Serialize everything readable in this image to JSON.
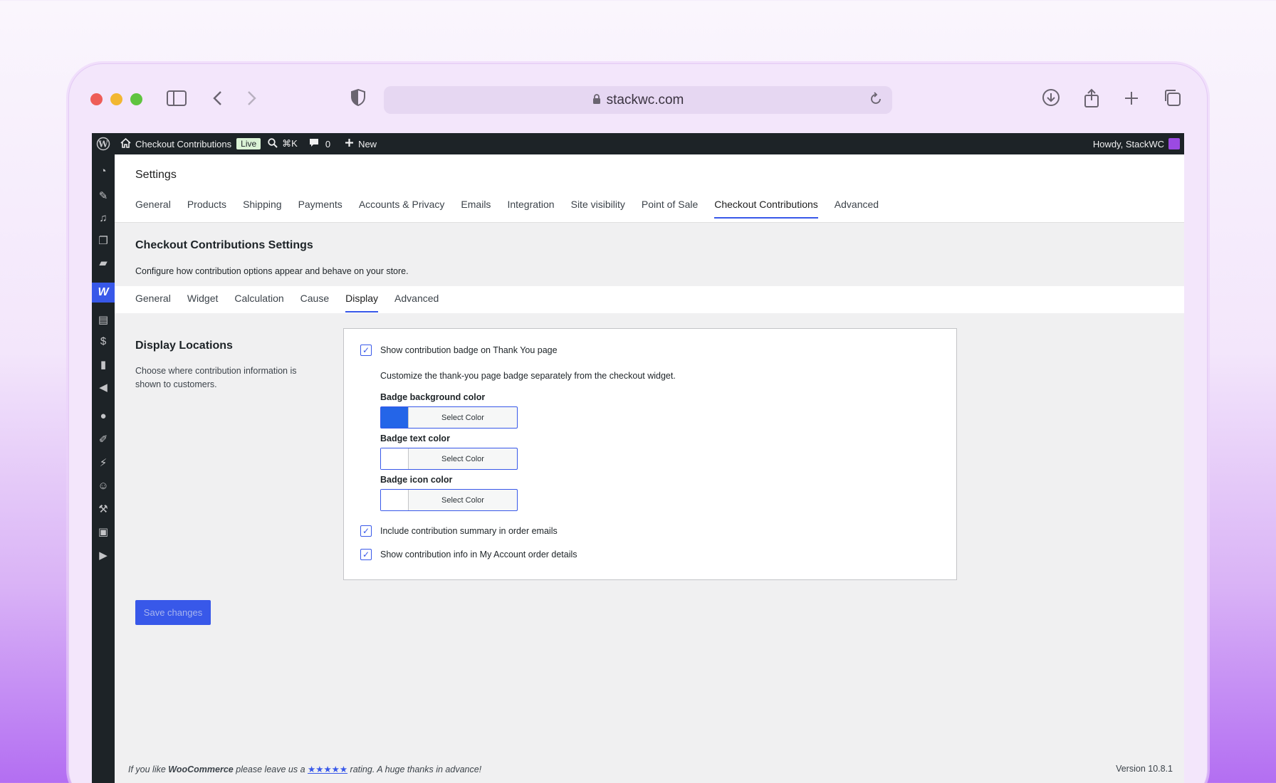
{
  "browser": {
    "url": "stackwc.com"
  },
  "adminbar": {
    "site_name": "Checkout Contributions",
    "live_badge": "Live",
    "search_shortcut": "⌘K",
    "comments_count": "0",
    "new_label": "New",
    "howdy": "Howdy, StackWC"
  },
  "settings": {
    "title": "Settings",
    "tabs": [
      {
        "label": "General"
      },
      {
        "label": "Products"
      },
      {
        "label": "Shipping"
      },
      {
        "label": "Payments"
      },
      {
        "label": "Accounts & Privacy"
      },
      {
        "label": "Emails"
      },
      {
        "label": "Integration"
      },
      {
        "label": "Site visibility"
      },
      {
        "label": "Point of Sale"
      },
      {
        "label": "Checkout Contributions",
        "active": true
      },
      {
        "label": "Advanced"
      }
    ]
  },
  "section": {
    "title": "Checkout Contributions Settings",
    "description": "Configure how contribution options appear and behave on your store."
  },
  "subtabs": [
    {
      "label": "General"
    },
    {
      "label": "Widget"
    },
    {
      "label": "Calculation"
    },
    {
      "label": "Cause"
    },
    {
      "label": "Display",
      "active": true
    },
    {
      "label": "Advanced"
    }
  ],
  "display_locations": {
    "title": "Display Locations",
    "description": "Choose where contribution information is shown to customers.",
    "thankyou_checkbox": {
      "label": "Show contribution badge on Thank You page",
      "checked": true
    },
    "thankyou_note": "Customize the thank-you page badge separately from the checkout widget.",
    "colors": [
      {
        "label": "Badge background color",
        "button": "Select Color",
        "color": "#2465e8"
      },
      {
        "label": "Badge text color",
        "button": "Select Color",
        "color": "#ffffff"
      },
      {
        "label": "Badge icon color",
        "button": "Select Color",
        "color": "#ffffff"
      }
    ],
    "emails_checkbox": {
      "label": "Include contribution summary in order emails",
      "checked": true
    },
    "account_checkbox": {
      "label": "Show contribution info in My Account order details",
      "checked": true
    }
  },
  "save_button": "Save changes",
  "footer": {
    "prefix": "If you like",
    "brand": "WooCommerce",
    "middle": "please leave us a",
    "stars": "★★★★★",
    "suffix": "rating. A huge thanks in advance!",
    "version": "Version 10.8.1"
  },
  "sidebar_icons": [
    "dashboard-icon",
    "pin-icon",
    "media-icon",
    "pages-icon",
    "comments-icon",
    "woocommerce-icon",
    "products-icon",
    "payments-icon",
    "analytics-icon",
    "marketing-icon",
    "astra-icon",
    "appearance-icon",
    "plugins-icon",
    "users-icon",
    "tools-icon",
    "settings-icon",
    "play-icon"
  ]
}
